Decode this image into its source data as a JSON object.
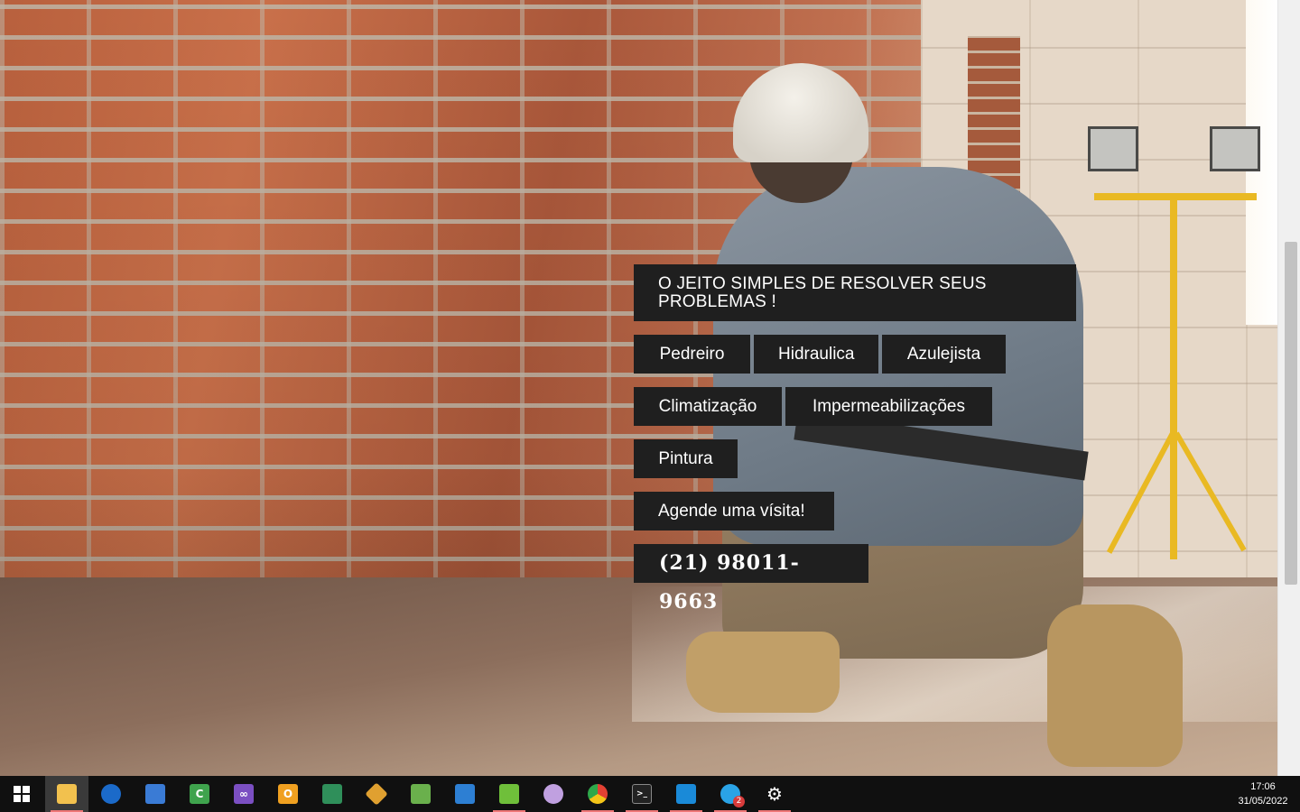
{
  "hero": {
    "headline": "O JEITO SIMPLES DE RESOLVER SEUS PROBLEMAS !",
    "services_row1": [
      "Pedreiro",
      "Hidraulica",
      "Azulejista"
    ],
    "services_row2": [
      "Climatização",
      "Impermeabilizações"
    ],
    "services_row3": [
      "Pintura"
    ],
    "cta_label": "Agende uma vísita!",
    "phone": "(21) 98011-9663"
  },
  "taskbar": {
    "apps": [
      {
        "name": "file-explorer",
        "color": "#f2c14e"
      },
      {
        "name": "firefox",
        "color": "#1b6ac9"
      },
      {
        "name": "remote-desktop",
        "color": "#3a7bd5"
      },
      {
        "name": "csharp-tool",
        "color": "#3fa34d"
      },
      {
        "name": "visual-studio",
        "color": "#7b4fc2"
      },
      {
        "name": "outlook-like",
        "color": "#f0a020"
      },
      {
        "name": "device-manager",
        "color": "#2f8f5a"
      },
      {
        "name": "git",
        "color": "#e0a030"
      },
      {
        "name": "snipping-tool",
        "color": "#6ab04c"
      },
      {
        "name": "paint",
        "color": "#2d7fd3"
      },
      {
        "name": "notepad-plus",
        "color": "#6fbf3a"
      },
      {
        "name": "paint-brush",
        "color": "#c0a0e0"
      },
      {
        "name": "chrome",
        "color": "#e34133"
      },
      {
        "name": "terminal",
        "color": "#222222"
      },
      {
        "name": "vscode",
        "color": "#1a8ad8"
      },
      {
        "name": "messaging",
        "color": "#2aa3e6"
      },
      {
        "name": "settings",
        "color": "#ffffff"
      }
    ],
    "notification_count": "2",
    "time": "17:06",
    "date": "31/05/2022"
  }
}
